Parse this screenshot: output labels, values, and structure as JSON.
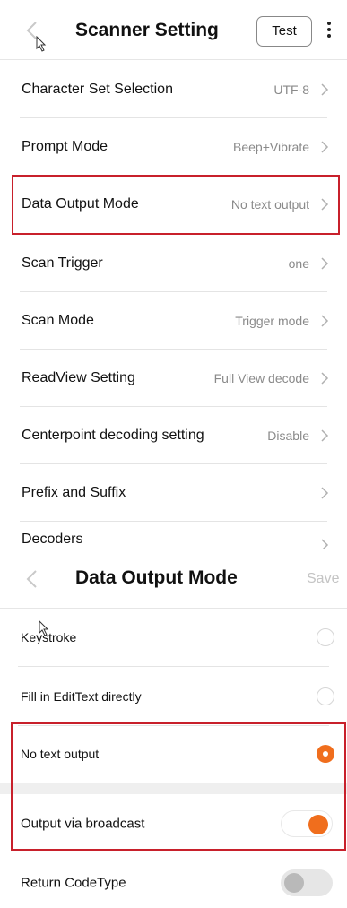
{
  "scanner_setting": {
    "title": "Scanner Setting",
    "test_label": "Test",
    "items": [
      {
        "label": "Character Set Selection",
        "value": "UTF-8"
      },
      {
        "label": "Prompt Mode",
        "value": "Beep+Vibrate"
      },
      {
        "label": "Data Output Mode",
        "value": "No text output"
      },
      {
        "label": "Scan Trigger",
        "value": "one"
      },
      {
        "label": "Scan Mode",
        "value": "Trigger mode"
      },
      {
        "label": "ReadView Setting",
        "value": "Full View decode"
      },
      {
        "label": "Centerpoint decoding setting",
        "value": "Disable"
      },
      {
        "label": "Prefix and Suffix",
        "value": ""
      },
      {
        "label": "Decoders",
        "value": ""
      }
    ]
  },
  "data_output_mode": {
    "title": "Data Output Mode",
    "save_label": "Save",
    "options": [
      {
        "label": "Keystroke",
        "selected": false
      },
      {
        "label": "Fill in EditText directly",
        "selected": false
      },
      {
        "label": "No text output",
        "selected": true
      }
    ],
    "toggles": [
      {
        "label": "Output via broadcast",
        "on": true
      },
      {
        "label": "Return CodeType",
        "on": false
      }
    ]
  },
  "colors": {
    "accent": "#f06e1d",
    "highlight_border": "#c8202b"
  }
}
